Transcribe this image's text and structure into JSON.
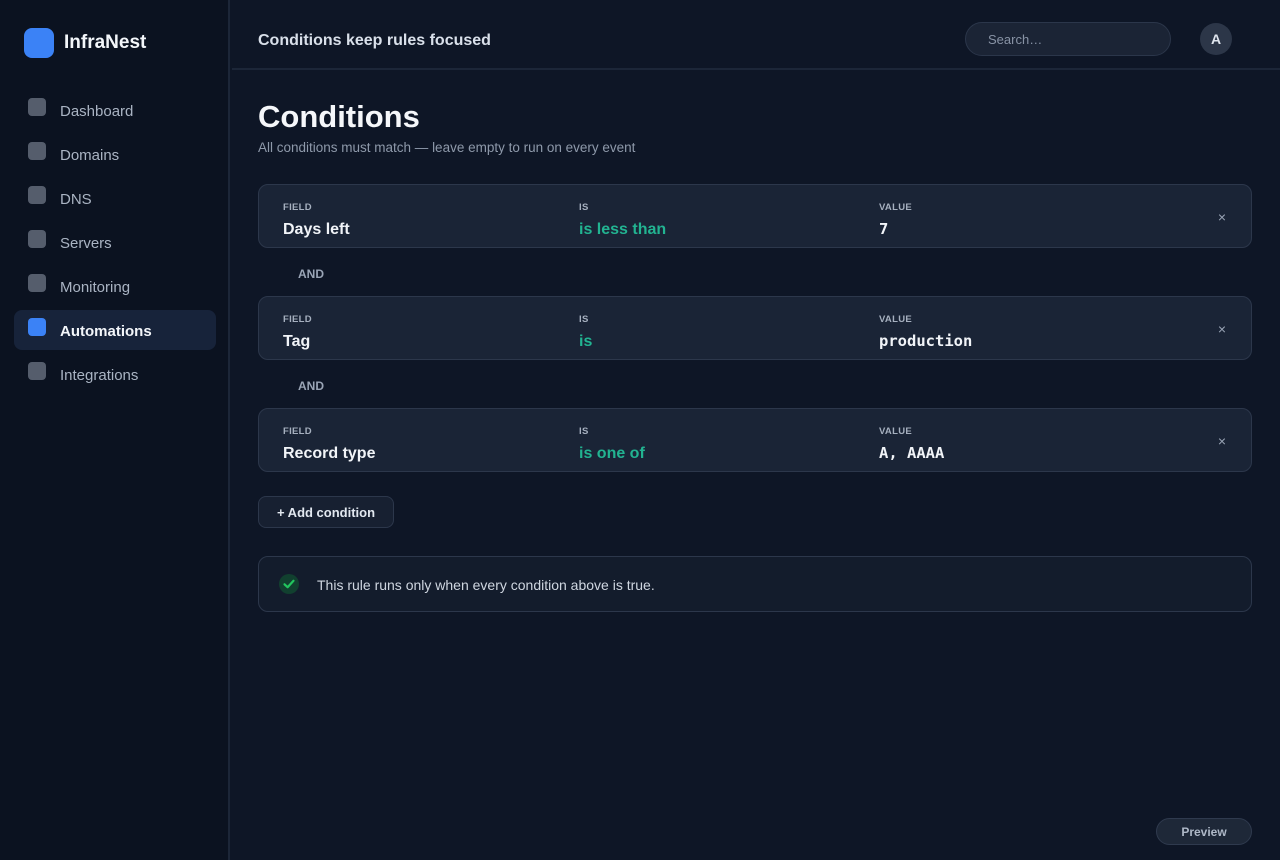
{
  "brand": {
    "name": "InfraNest"
  },
  "sidebar": {
    "items": [
      {
        "label": "Dashboard"
      },
      {
        "label": "Domains"
      },
      {
        "label": "DNS"
      },
      {
        "label": "Servers"
      },
      {
        "label": "Monitoring"
      },
      {
        "label": "Automations"
      },
      {
        "label": "Integrations"
      }
    ],
    "active": "Automations"
  },
  "header": {
    "title": "Conditions keep rules focused",
    "search_placeholder": "Search…",
    "avatar_initial": "A"
  },
  "main": {
    "title": "Conditions",
    "subtitle": "All conditions must match — leave empty to run on every event",
    "labels": {
      "field": "FIELD",
      "operator": "IS",
      "value": "VALUE"
    },
    "conditions": [
      {
        "field": "Days left",
        "operator": "is less than",
        "value": "7"
      },
      {
        "field": "Tag",
        "operator": "is",
        "value": "production"
      },
      {
        "field": "Record type",
        "operator": "is one of",
        "value": "A, AAAA"
      }
    ],
    "joiner": "AND",
    "remove_glyph": "×",
    "add_condition_label": "+ Add condition",
    "info_text": "This rule runs only when every condition above is true.",
    "preview_label": "Preview"
  },
  "colors": {
    "accent": "#3b82f6",
    "operator": "#22b391",
    "success": "#22c55e",
    "background": "#0e1626"
  },
  "icons": {
    "brand": "brand-logo-icon",
    "nav": "nav-square-icon",
    "remove": "close-icon",
    "info": "check-circle-icon"
  }
}
